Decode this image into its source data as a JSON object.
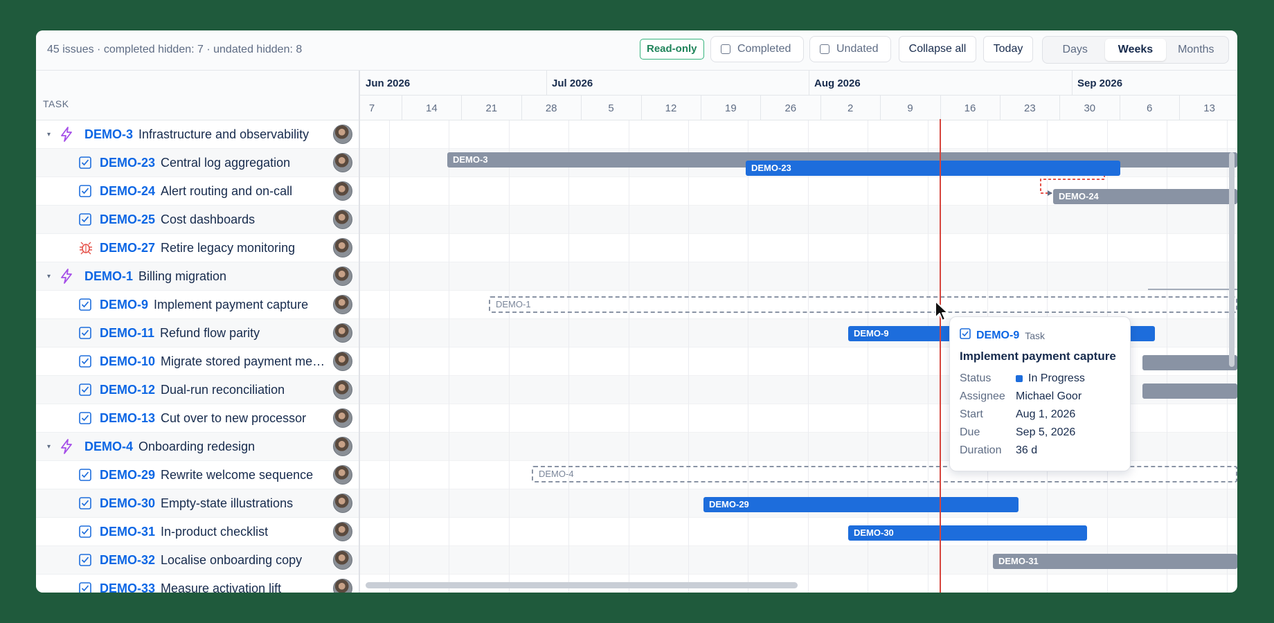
{
  "toolbar": {
    "summary": "45 issues · completed hidden: 7 · undated hidden: 8",
    "readonly_badge": "Read-only",
    "completed_label": "Completed",
    "undated_label": "Undated",
    "collapse_label": "Collapse all",
    "today_label": "Today",
    "scale_options": [
      "Days",
      "Weeks",
      "Months"
    ],
    "scale_selected": "Weeks"
  },
  "task_header": "TASK",
  "timeline": {
    "months": [
      "Jun 2026",
      "Jul 2026",
      "Aug 2026",
      "Sep 2026"
    ],
    "weeks": [
      "7",
      "14",
      "21",
      "28",
      "5",
      "12",
      "19",
      "26",
      "2",
      "9",
      "16",
      "23",
      "30",
      "6",
      "13"
    ]
  },
  "tasks": [
    {
      "key": "DEMO-3",
      "summary": "Infrastructure and observability",
      "type": "epic"
    },
    {
      "key": "DEMO-23",
      "summary": "Central log aggregation",
      "type": "task"
    },
    {
      "key": "DEMO-24",
      "summary": "Alert routing and on-call",
      "type": "task"
    },
    {
      "key": "DEMO-25",
      "summary": "Cost dashboards",
      "type": "task"
    },
    {
      "key": "DEMO-27",
      "summary": "Retire legacy monitoring",
      "type": "bug"
    },
    {
      "key": "DEMO-1",
      "summary": "Billing migration",
      "type": "epic"
    },
    {
      "key": "DEMO-9",
      "summary": "Implement payment capture",
      "type": "task"
    },
    {
      "key": "DEMO-11",
      "summary": "Refund flow parity",
      "type": "task"
    },
    {
      "key": "DEMO-10",
      "summary": "Migrate stored payment met…",
      "type": "task"
    },
    {
      "key": "DEMO-12",
      "summary": "Dual-run reconciliation",
      "type": "task"
    },
    {
      "key": "DEMO-13",
      "summary": "Cut over to new processor",
      "type": "task"
    },
    {
      "key": "DEMO-4",
      "summary": "Onboarding redesign",
      "type": "epic"
    },
    {
      "key": "DEMO-29",
      "summary": "Rewrite welcome sequence",
      "type": "task"
    },
    {
      "key": "DEMO-30",
      "summary": "Empty-state illustrations",
      "type": "task"
    },
    {
      "key": "DEMO-31",
      "summary": "In-product checklist",
      "type": "task"
    },
    {
      "key": "DEMO-32",
      "summary": "Localise onboarding copy",
      "type": "task"
    },
    {
      "key": "DEMO-33",
      "summary": "Measure activation lift",
      "type": "task"
    }
  ],
  "bars": {
    "demo3": "DEMO-3",
    "demo23": "DEMO-23",
    "demo24": "DEMO-24",
    "demo1": "DEMO-1",
    "demo9": "DEMO-9",
    "demo4": "DEMO-4",
    "demo29": "DEMO-29",
    "demo30": "DEMO-30",
    "demo31": "DEMO-31"
  },
  "tooltip": {
    "key": "DEMO-9",
    "type": "Task",
    "title": "Implement payment capture",
    "status_label": "Status",
    "status": "In Progress",
    "assignee_label": "Assignee",
    "assignee": "Michael Goor",
    "start_label": "Start",
    "start": "Aug 1, 2026",
    "due_label": "Due",
    "due": "Sep 5, 2026",
    "duration_label": "Duration",
    "duration": "36 d"
  },
  "colors": {
    "background": "#1f5a3c",
    "accent_blue": "#1d6ddc",
    "bar_gray": "#8993a4",
    "today_line": "#d6453d",
    "readonly_green": "#36b37e"
  }
}
